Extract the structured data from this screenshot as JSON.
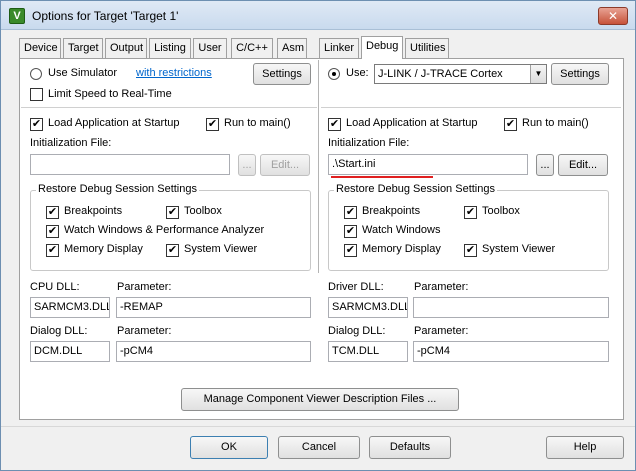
{
  "window": {
    "title": "Options for Target 'Target 1'",
    "app_icon_glyph": "V",
    "close_glyph": "✕"
  },
  "tabs": [
    "Device",
    "Target",
    "Output",
    "Listing",
    "User",
    "C/C++",
    "Asm",
    "Linker",
    "Debug",
    "Utilities"
  ],
  "active_tab": "Debug",
  "left": {
    "use_simulator_label": "Use Simulator",
    "restrictions_link": "with restrictions",
    "settings_label": "Settings",
    "limit_speed_label": "Limit Speed to Real-Time",
    "load_app_label": "Load Application at Startup",
    "run_to_main_label": "Run to main()",
    "init_file_label": "Initialization File:",
    "init_file_value": "",
    "browse_label": "...",
    "edit_label": "Edit...",
    "restore_group_title": "Restore Debug Session Settings",
    "breakpoints_label": "Breakpoints",
    "toolbox_label": "Toolbox",
    "watch_label": "Watch Windows & Performance Analyzer",
    "memory_label": "Memory Display",
    "sysviewer_label": "System Viewer",
    "cpu_dll_label": "CPU DLL:",
    "cpu_param_label": "Parameter:",
    "cpu_dll_value": "SARMCM3.DLL",
    "cpu_param_value": "-REMAP",
    "dialog_dll_label": "Dialog DLL:",
    "dialog_param_label": "Parameter:",
    "dialog_dll_value": "DCM.DLL",
    "dialog_param_value": "-pCM4"
  },
  "right": {
    "use_label": "Use:",
    "debugger_value": "J-LINK / J-TRACE Cortex",
    "settings_label": "Settings",
    "load_app_label": "Load Application at Startup",
    "run_to_main_label": "Run to main()",
    "init_file_label": "Initialization File:",
    "init_file_value": ".\\Start.ini",
    "browse_label": "...",
    "edit_label": "Edit...",
    "restore_group_title": "Restore Debug Session Settings",
    "breakpoints_label": "Breakpoints",
    "toolbox_label": "Toolbox",
    "watch_label": "Watch Windows",
    "memory_label": "Memory Display",
    "sysviewer_label": "System Viewer",
    "driver_dll_label": "Driver DLL:",
    "driver_param_label": "Parameter:",
    "driver_dll_value": "SARMCM3.DLL",
    "driver_param_value": "",
    "dialog_dll_label": "Dialog DLL:",
    "dialog_param_label": "Parameter:",
    "dialog_dll_value": "TCM.DLL",
    "dialog_param_value": "-pCM4"
  },
  "manage_button": "Manage Component Viewer Description Files ...",
  "footer": {
    "ok": "OK",
    "cancel": "Cancel",
    "defaults": "Defaults",
    "help": "Help"
  },
  "check_glyph": "✔",
  "dropdown_glyph": "▼",
  "colors": {
    "highlight_underline": "#e02020",
    "link": "#0066cc"
  }
}
